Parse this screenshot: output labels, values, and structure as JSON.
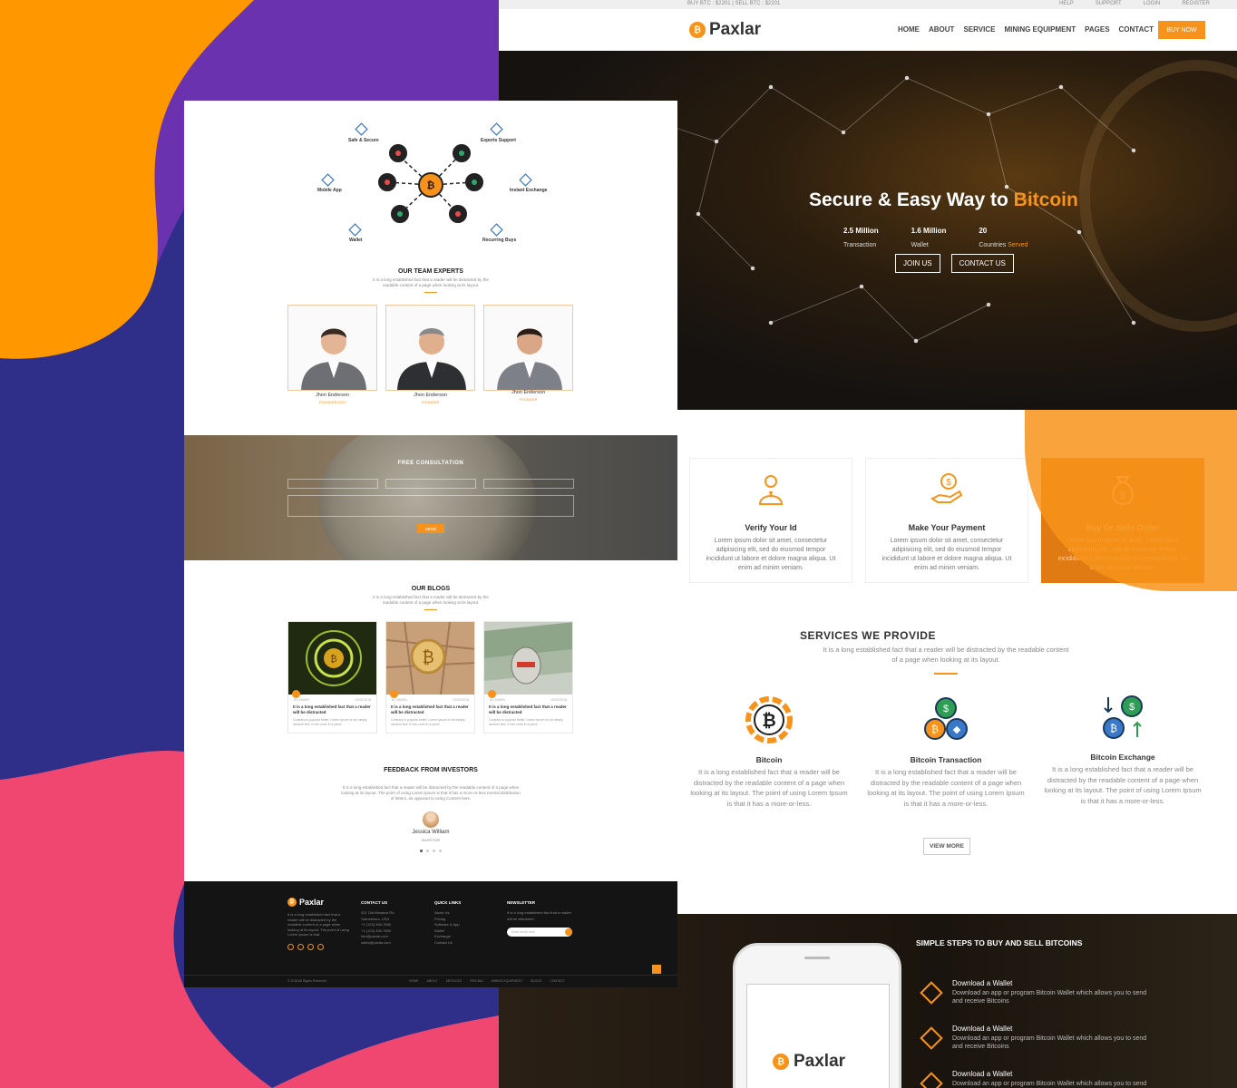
{
  "colors": {
    "accent": "#f7931a",
    "background_purple": "#2f2f8a",
    "blob_orange": "#ff9800",
    "blob_pink": "#ef476f",
    "footer": "#141414"
  },
  "right_page": {
    "topbar": {
      "ticker": "BUY BTC : $2201 | SELL BTC : $2201",
      "links": [
        "HELP",
        "SUPPORT",
        "LOGIN",
        "REGISTER"
      ]
    },
    "header": {
      "logo_text": "Paxlar",
      "nav": [
        "HOME",
        "ABOUT",
        "SERVICE",
        "MINING EQUIPMENT",
        "PAGES",
        "CONTACT"
      ],
      "cta": "BUY NOW"
    },
    "hero": {
      "title_prefix": "Secure & Easy Way to ",
      "title_highlight": "Bitcoin",
      "stats": [
        {
          "value": "2.5 Million",
          "label": "Transaction",
          "label_highlight": ""
        },
        {
          "value": "1.6 Million",
          "label": "Wallet",
          "label_highlight": ""
        },
        {
          "value": "20",
          "label": "Countries ",
          "label_highlight": "Served"
        }
      ],
      "buttons": [
        "JOIN US",
        "CONTACT US"
      ]
    },
    "steps": [
      {
        "icon": "user-tie-icon",
        "title": "Verify Your Id",
        "text": "Lorem ipsum dolor sit amet, consectetur adipisicing elit, sed do eiusmod tempor incididunt ut labore et dolore magna aliqua. Ut enim ad minim veniam."
      },
      {
        "icon": "hand-coin-icon",
        "title": "Make Your Payment",
        "text": "Lorem ipsum dolor sit amet, consectetur adipisicing elit, sed do eiusmod tempor incididunt ut labore et dolore magna aliqua. Ut enim ad minim veniam."
      },
      {
        "icon": "money-bag-icon",
        "title": "Buy Or Sells Order",
        "text": "Lorem ipsum dolor sit amet, consectetur adipisicing elit, sed do eiusmod tempor incididunt ut labore et dolore magna aliqua. Ut enim ad minim veniam."
      }
    ],
    "services": {
      "title": "SERVICES WE PROVIDE",
      "subtitle": "It is a long established fact that a reader will be distracted by the readable content of a page when looking at its layout.",
      "items": [
        {
          "icon": "bitcoin-icon",
          "title": "Bitcoin",
          "text": "It is a long established fact that a reader will be distracted by the readable content of a page when looking at its layout. The point of using Lorem Ipsum is that it has a more-or-less."
        },
        {
          "icon": "bitcoin-transaction-icon",
          "title": "Bitcoin Transaction",
          "text": "It is a long established fact that a reader will be distracted by the readable content of a page when looking at its layout. The point of using Lorem Ipsum is that it has a more-or-less."
        },
        {
          "icon": "bitcoin-exchange-icon",
          "title": "Bitcoin Exchange",
          "text": "It is a long established fact that a reader will be distracted by the readable content of a page when looking at its layout. The point of using Lorem Ipsum is that it has a more-or-less."
        }
      ],
      "view_more": "VIEW MORE"
    },
    "simple_steps": {
      "title": "SIMPLE STEPS TO BUY AND SELL BITCOINS",
      "phone_logo": "Paxlar",
      "items": [
        {
          "title": "Download a Wallet",
          "text": "Download an app or program Bitcoin Wallet which allows you to send and receive Bitcoins"
        },
        {
          "title": "Download a Wallet",
          "text": "Download an app or program Bitcoin Wallet which allows you to send and receive Bitcoins"
        },
        {
          "title": "Download a Wallet",
          "text": "Download an app or program Bitcoin Wallet which allows you to send and receive Bitcoins"
        }
      ]
    }
  },
  "left_page": {
    "features": [
      "Safe & Secure",
      "Experts Support",
      "Mobile App",
      "Instant Exchange",
      "Wallet",
      "Recurring Buys"
    ],
    "team": {
      "title": "OUR TEAM EXPERTS",
      "subtitle": "It is a long established fact that a reader will be distracted by the readable content of a page when looking at its layout.",
      "members": [
        {
          "name": "Jhon Enderson",
          "role": "FOUNDER/CEO"
        },
        {
          "name": "Jhon Enderson",
          "role": "FOUNDER"
        },
        {
          "name": "Jhon Enderson",
          "role": "FOUNDER"
        }
      ]
    },
    "consultation": {
      "title": "FREE CONSULTATION",
      "send": "SEND"
    },
    "blogs": {
      "title": "OUR BLOGS",
      "subtitle": "It is a long established fact that a reader will be distracted by the readable content of a page when looking at its layout.",
      "posts": [
        {
          "meta_left": "BY ADMIN",
          "meta_right": "02/02/2018",
          "title": "It is a long established fact that a reader will be distracted",
          "text": "Contrary to popular belief, Lorem Ipsum is not simply random text. It has roots in a piece"
        },
        {
          "meta_left": "BY ADMIN",
          "meta_right": "02/02/2018",
          "title": "It is a long established fact that a reader will be distracted",
          "text": "Contrary to popular belief, Lorem Ipsum is not simply random text. It has roots in a piece"
        },
        {
          "meta_left": "BY ADMIN",
          "meta_right": "02/02/2018",
          "title": "It is a long established fact that a reader will be distracted",
          "text": "Contrary to popular belief, Lorem Ipsum is not simply random text. It has roots in a piece"
        }
      ]
    },
    "feedback": {
      "title": "FEEDBACK FROM INVESTORS",
      "quote": "It is a long established fact that a reader will be distracted by the readable content of a page when looking at its layout. The point of using Lorem Ipsum is that it has a more-or-less normal distribution of letters, as opposed to using Content here.",
      "name": "Jessica William",
      "role": "INVESTOR"
    },
    "footer": {
      "logo_text": "Paxlar",
      "about": "It is a long established fact that a reader will be distracted by the readable content of a page when looking at its layout. The point of using Lorem Ipsum is that.",
      "contact_title": "CONTACT US",
      "contact": [
        "321 Old Meadow Rd",
        "Gainesboro, USA",
        "+1 (123) 456-7890",
        "+1 (123) 456-7890",
        "info@paxlar.com",
        "sales@paxlar.com"
      ],
      "links_title": "QUICK LINKS",
      "links": [
        "About Us",
        "Pricing",
        "Software & App",
        "Wallet",
        "Exchange",
        "Contact Us"
      ],
      "newsletter_title": "NEWSLETTER",
      "newsletter_text": "It is a long established fact that a reader will be distracted",
      "newsletter_placeholder": "Enter email here",
      "copyright": "© 2018 All Rights Reserved",
      "menu": [
        "HOME",
        "ABOUT",
        "SERVICES",
        "PRICING",
        "MINING EQUIPMENT",
        "BLOGS",
        "CONTACT"
      ]
    }
  }
}
